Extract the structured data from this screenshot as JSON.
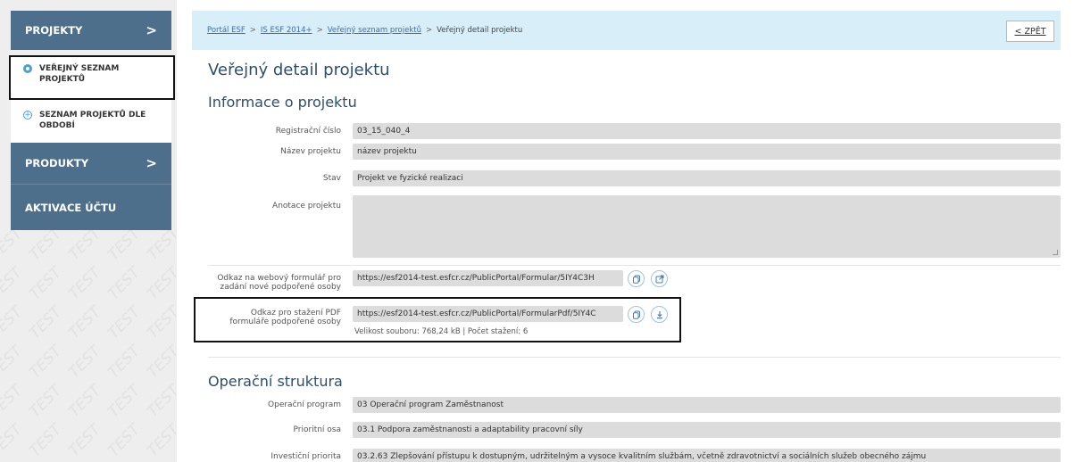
{
  "sidebar": {
    "projekty": "PROJEKTY",
    "projekty_arrow": ">",
    "verejny_seznam": [
      "VEŘEJNÝ SEZNAM",
      "PROJEKTŮ"
    ],
    "seznam_dle_obdobi": [
      "SEZNAM PROJEKTŮ DLE",
      "OBDOBÍ"
    ],
    "produkty": "PRODUKTY",
    "produkty_arrow": ">",
    "aktivace": "AKTIVACE ÚČTU",
    "watermark": "TEST"
  },
  "breadcrumb": {
    "items": [
      "Portál ESF",
      "IS ESF 2014+",
      "Veřejný seznam projektů",
      "Veřejný detail projektu"
    ],
    "separator": ">"
  },
  "back_button": "< ZPĚT",
  "page_title": "Veřejný detail projektu",
  "section_info": {
    "title": "Informace o projektu",
    "registracni_cislo": {
      "label": "Registrační číslo",
      "value": "03_15_040_4"
    },
    "nazev_projektu": {
      "label": "Název projektu",
      "value": "název projektu"
    },
    "stav": {
      "label": "Stav",
      "value": "Projekt ve fyzické realizaci"
    },
    "anotace": {
      "label": "Anotace projektu",
      "value": ""
    },
    "odkaz_formular": {
      "label": [
        "Odkaz na webový formulář pro",
        "zadání nové podpořené osoby"
      ],
      "value": "https://esf2014-test.esfcr.cz/PublicPortal/Formular/5IY4C3H"
    },
    "odkaz_pdf": {
      "label": [
        "Odkaz pro stažení PDF",
        "formuláře podpořené osoby"
      ],
      "value": "https://esf2014-test.esfcr.cz/PublicPortal/FormularPdf/5IY4C",
      "meta": "Velikost souboru: 768,24 kB | Počet stažení: 6"
    }
  },
  "section_oper": {
    "title": "Operační struktura",
    "operacni_program": {
      "label": "Operační program",
      "value": "03 Operační program Zaměstnanost"
    },
    "prioritni_osa": {
      "label": "Prioritní osa",
      "value": "03.1 Podpora zaměstnanosti a adaptability pracovní síly"
    },
    "investicni_priorita": {
      "label": "Investiční priorita",
      "value": "03.2.63 Zlepšování přístupu k dostupným, udržitelným a vysoce kvalitním službám, včetně zdravotnictví a sociálních služeb obecného zájmu"
    }
  },
  "icons": {
    "copy": "copy-icon",
    "external_link": "external-link-icon",
    "download": "download-icon",
    "chevron": "chevron-right-icon",
    "radio": "circle-icon",
    "plus": "plus-circle-icon"
  },
  "colors": {
    "nav_bg": "#4e6f8c",
    "breadcrumb_bg": "#d8eef9",
    "heading": "#2e4e6e",
    "link": "#3b6ea8",
    "field_bg": "#dcdcdc",
    "accent": "#4a9fd5"
  }
}
